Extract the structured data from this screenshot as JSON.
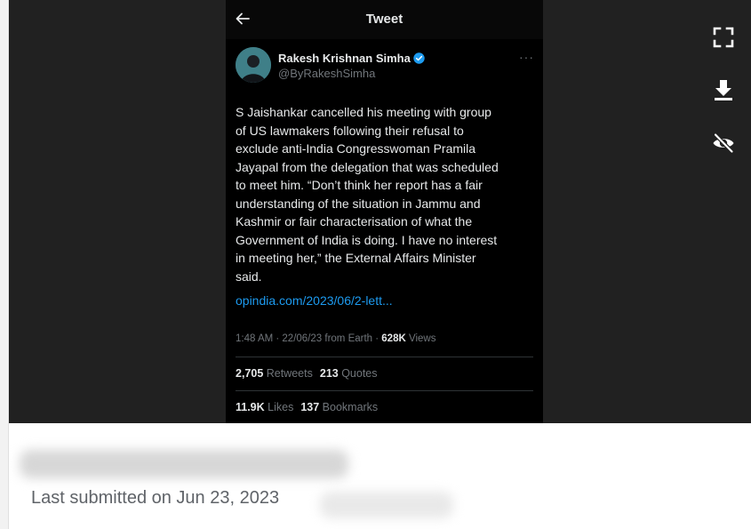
{
  "header": {
    "title": "Tweet"
  },
  "author": {
    "name": "Rakesh Krishnan Simha",
    "handle": "@ByRakeshSimha"
  },
  "tweet": {
    "text": "S Jaishankar cancelled his meeting with group\nof US lawmakers following their refusal to\nexclude anti-India Congresswoman Pramila\nJayapal from the delegation that was scheduled\nto meet him. “Don’t think her report has a fair\nunderstanding of the situation in Jammu and\nKashmir or fair characterisation of what the\nGovernment of India is doing. I have no interest\nin meeting her,” the External Affairs Minister\nsaid.",
    "link": "opindia.com/2023/06/2-lett...",
    "meta_prefix": "1:48 AM · 22/06/23 from Earth · ",
    "views_count": "628K",
    "views_label": " Views"
  },
  "stats": {
    "retweets_count": "2,705",
    "retweets_label": " Retweets",
    "quotes_count": "213",
    "quotes_label": " Quotes",
    "likes_count": "11.9K",
    "likes_label": " Likes",
    "bookmarks_count": "137",
    "bookmarks_label": " Bookmarks"
  },
  "footer": {
    "submitted": "Last submitted on Jun 23, 2023"
  },
  "icons": {
    "back": "arrow-left-icon",
    "verified": "verified-badge-icon",
    "more": "more-horizontal-icon",
    "fullscreen": "fullscreen-icon",
    "download": "download-icon",
    "hide": "eye-off-icon"
  },
  "colors": {
    "link": "#1d9bf0",
    "verified": "#1d9bf0",
    "viewer_bg": "#212121",
    "tweet_bg": "#000000"
  }
}
